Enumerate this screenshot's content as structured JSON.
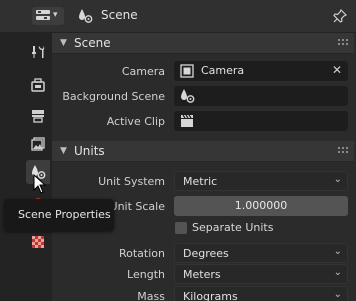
{
  "header": {
    "title": "Scene",
    "editor_icon": "properties-editor-icon",
    "context_icon": "scene-icon",
    "pin_icon": "pin-icon"
  },
  "tabs": [
    {
      "name": "tool-tab",
      "icon": "tool-icon",
      "active": false
    },
    {
      "name": "render-tab",
      "icon": "render-icon",
      "active": false
    },
    {
      "name": "output-tab",
      "icon": "output-icon",
      "active": false
    },
    {
      "name": "view-layer-tab",
      "icon": "view-layer-icon",
      "active": false
    },
    {
      "name": "scene-tab",
      "icon": "scene-icon",
      "active": true
    },
    {
      "name": "world-tab",
      "icon": "world-icon",
      "active": false
    },
    {
      "name": "texture-tab",
      "icon": "texture-icon",
      "active": false
    }
  ],
  "scene_panel": {
    "title": "Scene",
    "camera_label": "Camera",
    "camera_value": "Camera",
    "background_scene_label": "Background Scene",
    "active_clip_label": "Active Clip"
  },
  "units_panel": {
    "title": "Units",
    "unit_system_label": "Unit System",
    "unit_system_value": "Metric",
    "unit_scale_label": "Unit Scale",
    "unit_scale_value": "1.000000",
    "separate_units_label": "Separate Units",
    "separate_units_checked": false,
    "rotation_label": "Rotation",
    "rotation_value": "Degrees",
    "length_label": "Length",
    "length_value": "Meters",
    "mass_label": "Mass",
    "mass_value": "Kilograms"
  },
  "tooltip": {
    "text": "Scene Properties"
  },
  "colors": {
    "background": "#2b2b2b",
    "header": "#303030",
    "tab_strip": "#232323",
    "field": "#1d1d1d",
    "number_field": "#545454",
    "active_icon_orange": "#e89c3c"
  }
}
